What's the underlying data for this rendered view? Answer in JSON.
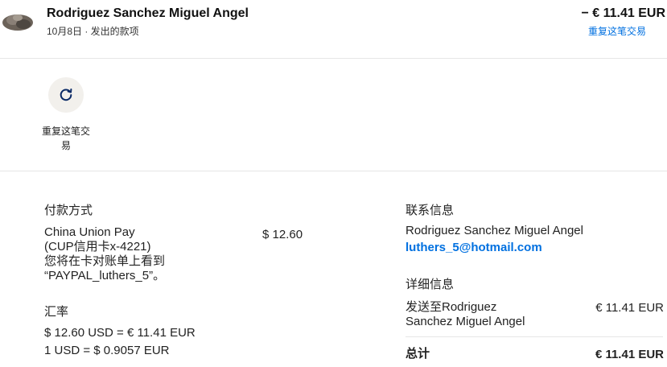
{
  "header": {
    "name": "Rodriguez Sanchez Miguel Angel",
    "subtitle": "10月8日 · 发出的款项",
    "amount": "− € 11.41 EUR",
    "repeat_link": "重复这笔交易"
  },
  "actions": {
    "repeat_label": "重复这笔交易"
  },
  "payment": {
    "heading": "付款方式",
    "method_line1": "China Union Pay",
    "method_line2": "(CUP信用卡x-4221)",
    "method_line3": "您将在卡对账单上看到",
    "method_line4": "“PAYPAL_luthers_5”。",
    "amount": "$ 12.60"
  },
  "exchange": {
    "heading": "汇率",
    "line1": "$ 12.60 USD = € 11.41 EUR",
    "line2": "1 USD = $ 0.9057 EUR"
  },
  "contact": {
    "heading": "联系信息",
    "name": "Rodriguez Sanchez Miguel Angel",
    "email": "luthers_5@hotmail.com"
  },
  "details": {
    "heading": "详细信息",
    "sent_to_line1": "发送至Rodriguez",
    "sent_to_line2": "Sanchez Miguel Angel",
    "sent_amount": "€ 11.41 EUR",
    "total_label": "总计",
    "total_amount": "€ 11.41 EUR"
  },
  "colors": {
    "link": "#0070e0",
    "text": "#222222",
    "action_bg": "#f2f0ec"
  },
  "icons": {
    "repeat": "refresh-icon"
  }
}
